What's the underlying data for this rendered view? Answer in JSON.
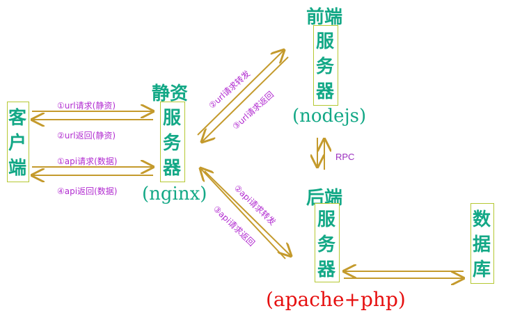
{
  "client": {
    "label": "客户端"
  },
  "static_server": {
    "title": "静资",
    "label": "服务器",
    "name": "(nginx)"
  },
  "frontend_server": {
    "title": "前端",
    "label": "服务器",
    "name": "(nodejs)"
  },
  "backend_server": {
    "title": "后端",
    "label": "服务器",
    "name": "(apache+php)"
  },
  "database": {
    "label": "数据库"
  },
  "arrows": {
    "url_request": "①url请求(静资)",
    "url_return": "②url返回(静资)",
    "api_request": "①api请求(数据)",
    "api_return": "④api返回(数据)",
    "url_forward": "②url请求转发",
    "url_back": "③url请求返回",
    "api_forward": "②api请求转发",
    "api_back": "③api请求返回",
    "rpc": "RPC"
  },
  "colors": {
    "box_border": "#b5c832",
    "text": "#13a886",
    "label": "#b12bd0",
    "arrow": "#c49a2c",
    "apache": "#e60f0f"
  }
}
